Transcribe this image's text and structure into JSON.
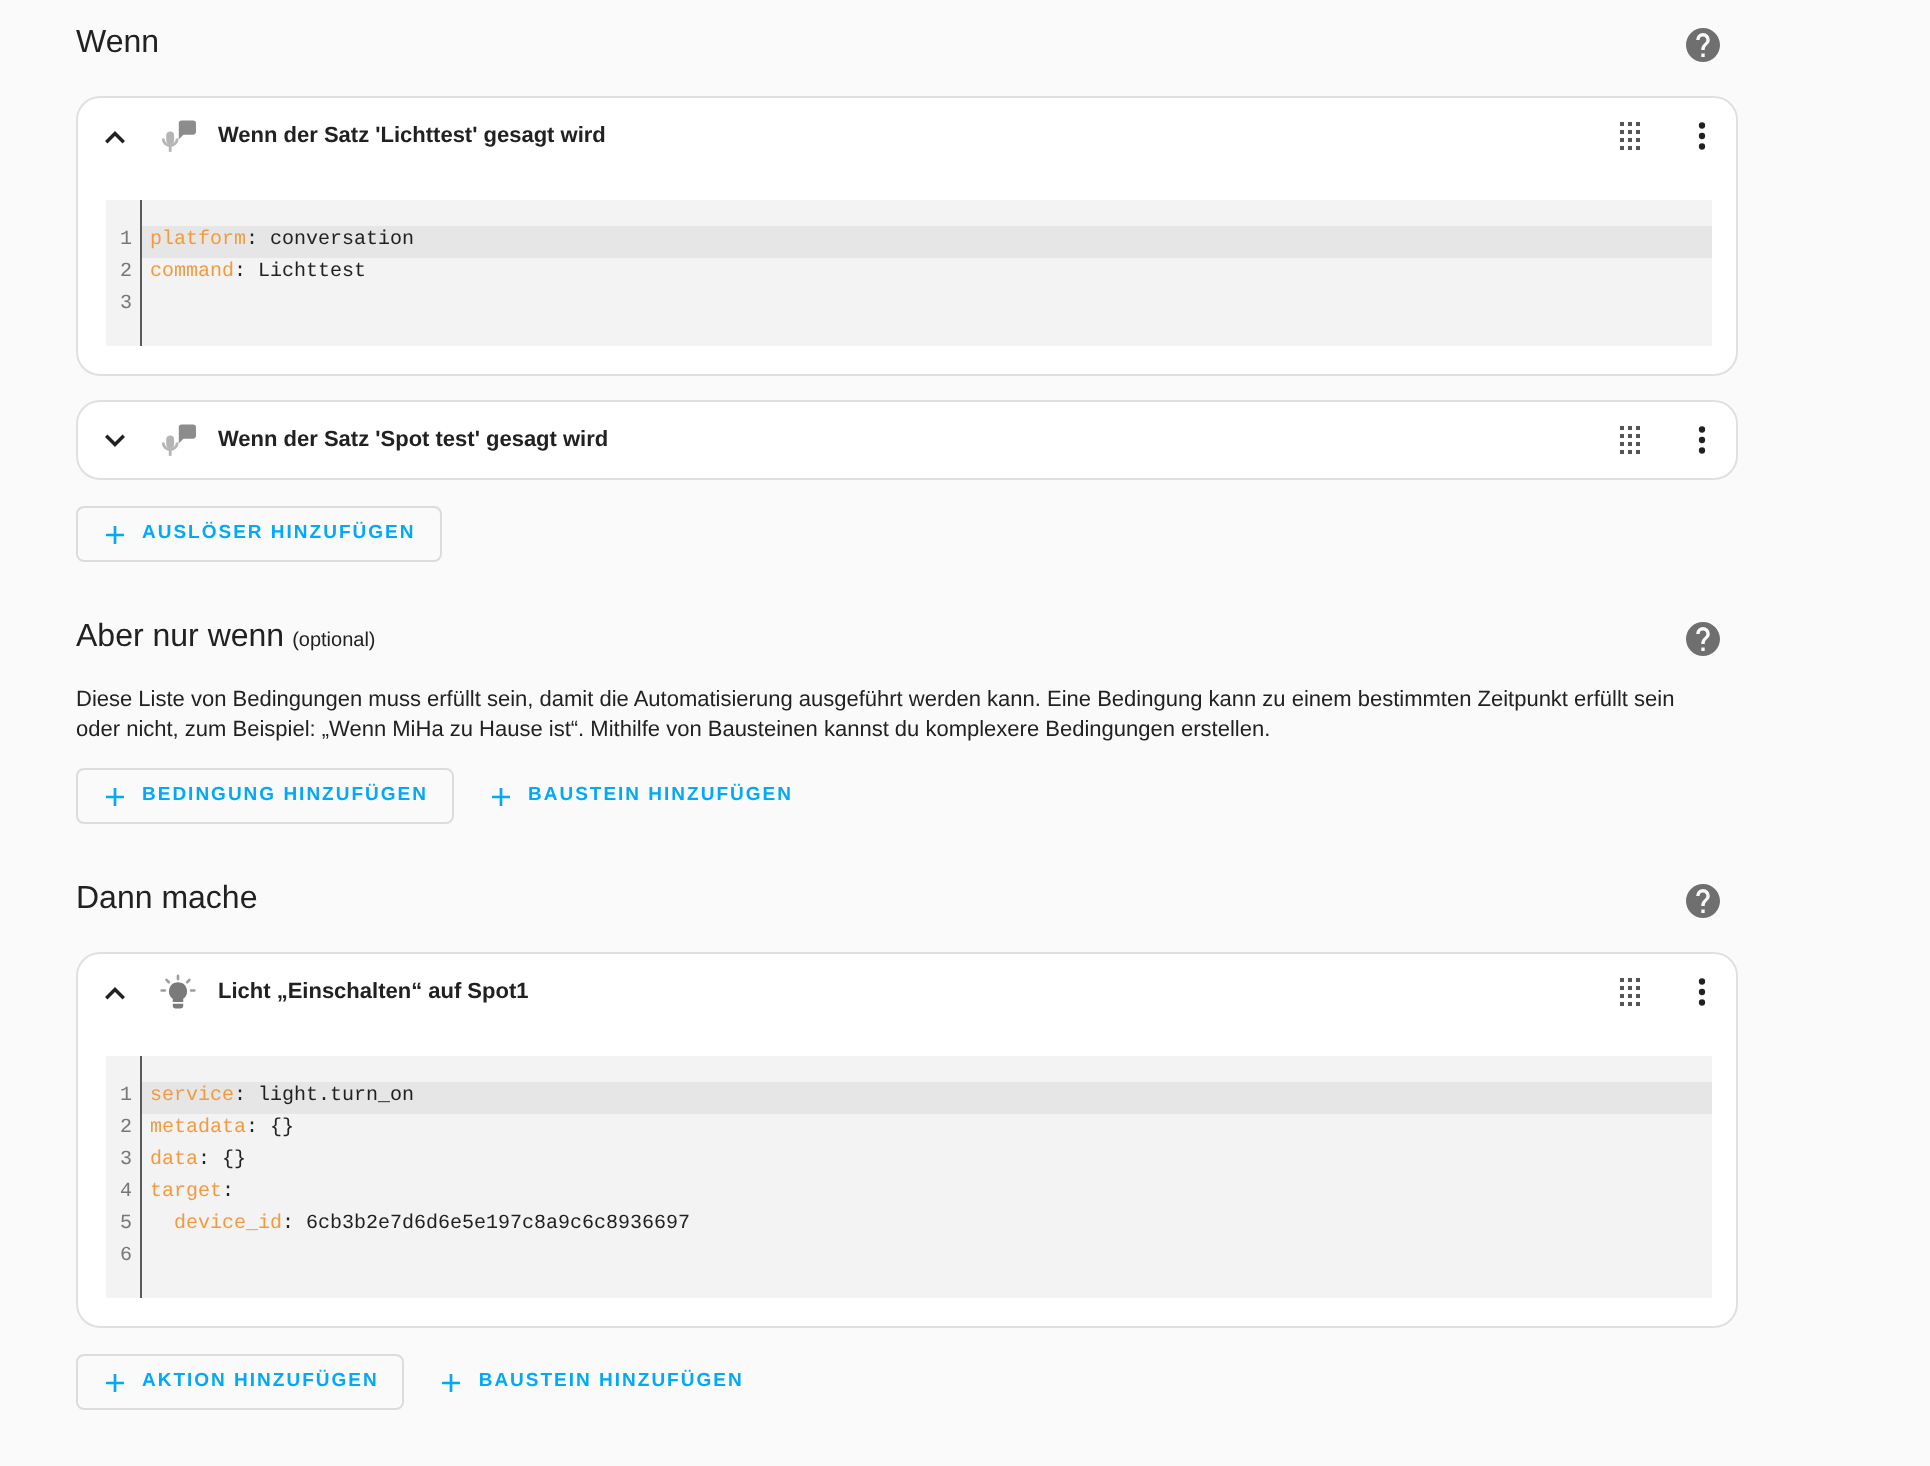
{
  "sections": [
    {
      "title": "Wenn",
      "items": [
        {
          "kind": "conversation",
          "title": "Wenn der Satz 'Lichttest' gesagt wird",
          "expanded": true,
          "code": [
            {
              "number": "1",
              "highlighted": true,
              "tokens": [
                {
                  "kind": "key",
                  "text": "platform"
                },
                {
                  "kind": "plain",
                  "text": ": conversation"
                }
              ]
            },
            {
              "number": "2",
              "highlighted": false,
              "tokens": [
                {
                  "kind": "key",
                  "text": "command"
                },
                {
                  "kind": "plain",
                  "text": ": Lichttest"
                }
              ]
            },
            {
              "number": "3",
              "highlighted": false
            }
          ]
        },
        {
          "kind": "conversation",
          "title": "Wenn der Satz 'Spot test' gesagt wird",
          "expanded": false
        }
      ],
      "buttons": [
        {
          "kind": "outlined",
          "label": "AUSLÖSER HINZUFÜGEN"
        }
      ]
    },
    {
      "title": "Aber nur wenn",
      "note": "(optional)",
      "description": "Diese Liste von Bedingungen muss erfüllt sein, damit die Automatisierung ausgeführt werden kann. Eine Bedingung kann zu einem bestimmten Zeitpunkt erfüllt sein oder nicht, zum Beispiel: „Wenn MiHa zu Hause ist“. Mithilfe von Bausteinen kannst du komplexere Bedingungen erstellen.",
      "buttons": [
        {
          "kind": "outlined",
          "label": "BEDINGUNG HINZUFÜGEN"
        },
        {
          "kind": "text",
          "label": "BAUSTEIN HINZUFÜGEN"
        }
      ]
    },
    {
      "title": "Dann mache",
      "items": [
        {
          "kind": "light",
          "title": "Licht „Einschalten“ auf Spot1",
          "expanded": true,
          "code": [
            {
              "number": "1",
              "highlighted": true,
              "tokens": [
                {
                  "kind": "key",
                  "text": "service"
                },
                {
                  "kind": "plain",
                  "text": ": light.turn_on"
                }
              ]
            },
            {
              "number": "2",
              "highlighted": false,
              "tokens": [
                {
                  "kind": "key",
                  "text": "metadata"
                },
                {
                  "kind": "plain",
                  "text": ": {}"
                }
              ]
            },
            {
              "number": "3",
              "highlighted": false,
              "tokens": [
                {
                  "kind": "key",
                  "text": "data"
                },
                {
                  "kind": "plain",
                  "text": ": {}"
                }
              ]
            },
            {
              "number": "4",
              "highlighted": false,
              "tokens": [
                {
                  "kind": "key",
                  "text": "target"
                },
                {
                  "kind": "plain",
                  "text": ":"
                }
              ],
              "children": [
                {
                  "number": "5",
                  "highlighted": false,
                  "tokens": [
                    {
                      "kind": "key",
                      "text": "device_id"
                    },
                    {
                      "kind": "plain",
                      "text": ": 6cb3b2e7d6d6e5e197c8a9c6c8936697"
                    }
                  ]
                }
              ]
            },
            {
              "number": "6",
              "highlighted": false
            }
          ]
        }
      ],
      "buttons": [
        {
          "kind": "outlined",
          "label": "AKTION HINZUFÜGEN"
        },
        {
          "kind": "text",
          "label": "BAUSTEIN HINZUFÜGEN"
        }
      ]
    }
  ]
}
